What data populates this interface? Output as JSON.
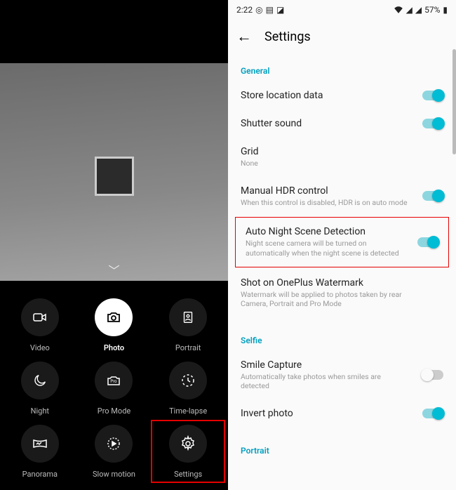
{
  "camera": {
    "modes": [
      {
        "id": "video",
        "label": "Video"
      },
      {
        "id": "photo",
        "label": "Photo"
      },
      {
        "id": "portrait",
        "label": "Portrait"
      },
      {
        "id": "night",
        "label": "Night"
      },
      {
        "id": "promode",
        "label": "Pro Mode"
      },
      {
        "id": "timelapse",
        "label": "Time-lapse"
      },
      {
        "id": "panorama",
        "label": "Panorama"
      },
      {
        "id": "slowmotion",
        "label": "Slow motion"
      },
      {
        "id": "settings",
        "label": "Settings"
      }
    ],
    "active_mode": "photo",
    "highlighted_mode": "settings"
  },
  "status": {
    "time": "2:22",
    "battery": "57%"
  },
  "settings": {
    "title": "Settings",
    "sections": {
      "general": {
        "header": "General",
        "items": {
          "location": {
            "title": "Store location data",
            "toggle": true
          },
          "shutter": {
            "title": "Shutter sound",
            "toggle": true
          },
          "grid": {
            "title": "Grid",
            "sub": "None"
          },
          "hdr": {
            "title": "Manual HDR control",
            "sub": "When this control is disabled, HDR is on auto mode",
            "toggle": true
          },
          "night": {
            "title": "Auto Night Scene Detection",
            "sub": "Night scene camera will be turned on automatically when the night scene is detected",
            "toggle": true
          },
          "watermark": {
            "title": "Shot on OnePlus Watermark",
            "sub": "Watermark will be applied to photos taken by rear Camera, Portrait and Pro Mode"
          }
        }
      },
      "selfie": {
        "header": "Selfie",
        "items": {
          "smile": {
            "title": "Smile Capture",
            "sub": "Automatically take photos when smiles are detected",
            "toggle": false
          },
          "invert": {
            "title": "Invert photo",
            "toggle": true
          }
        }
      },
      "portrait": {
        "header": "Portrait"
      }
    },
    "highlighted_setting": "night"
  }
}
